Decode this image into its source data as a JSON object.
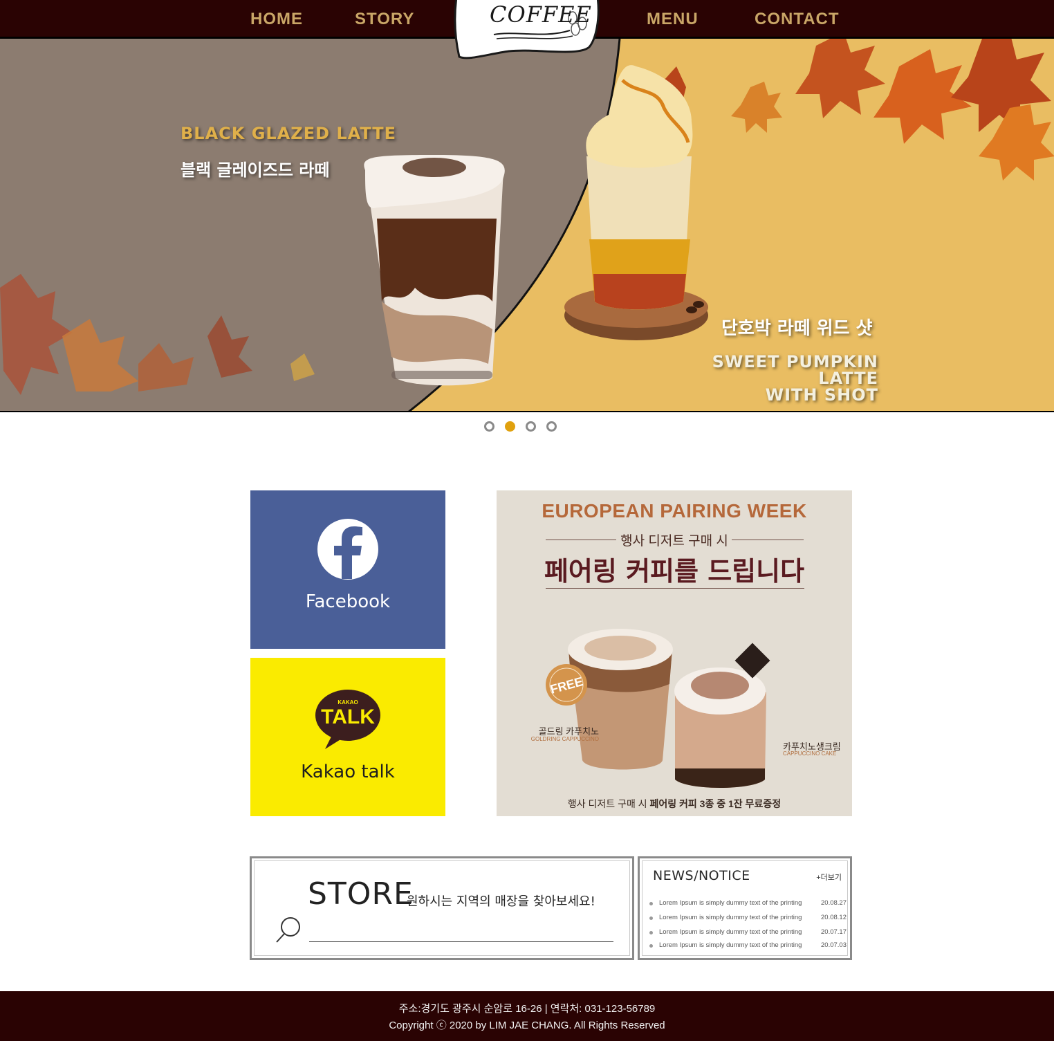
{
  "nav": {
    "home": "HOME",
    "story": "STORY",
    "menu": "MENU",
    "contact": "CONTACT",
    "logo": "COFFEE"
  },
  "hero": {
    "left_title_en": "BLACK GLAZED LATTE",
    "left_title_ko": "블랙 글레이즈드 라떼",
    "right_title_ko": "단호박 라떼 위드 샷",
    "right_title_en_line1": "SWEET PUMPKIN LATTE",
    "right_title_en_line2": "WITH SHOT",
    "colors": {
      "left_bg": "#8c7c70",
      "right_bg": "#e9bd62"
    }
  },
  "slider": {
    "count": 4,
    "active": 2
  },
  "social": {
    "facebook_label": "Facebook",
    "kakao_label": "Kakao talk",
    "kakao_logo_small": "KAKAO",
    "kakao_logo_big": "TALK",
    "facebook_color": "#4a5f98",
    "kakao_color": "#faeb00"
  },
  "promo": {
    "title": "EUROPEAN PAIRING WEEK",
    "subtitle": "행사 디저트 구매 시",
    "headline": "페어링 커피를 드립니다",
    "badge": "FREE",
    "item1_ko": "골드링 카푸치노",
    "item1_en": "GOLDRING CAPPUCCINO",
    "item2_ko": "카푸치노생크림",
    "item2_en": "CAPPUCCINO CAKE",
    "footer_prefix": "행사 디저트 구매 시",
    "footer_bold": "페어링 커피 3종 중 1잔 무료증정"
  },
  "store": {
    "title": "STORE",
    "description": "원하시는 지역의 매장을 찾아보세요!",
    "search_value": "",
    "search_icon": "search-icon"
  },
  "news": {
    "title": "NEWS/NOTICE",
    "more": "+더보기",
    "items": [
      {
        "text": "Lorem Ipsum is simply dummy text of the printing",
        "date": "20.08.27"
      },
      {
        "text": "Lorem Ipsum is simply dummy text of the printing",
        "date": "20.08.12"
      },
      {
        "text": "Lorem Ipsum is simply dummy text of the printing",
        "date": "20.07.17"
      },
      {
        "text": "Lorem Ipsum is simply dummy text of the printing",
        "date": "20.07.03"
      }
    ]
  },
  "footer": {
    "address": "주소:경기도 광주시 순암로 16-26   |  연락처: 031-123-56789",
    "copyright": "Copyright ⓒ 2020 by LIM JAE CHANG. All Rights Reserved"
  }
}
